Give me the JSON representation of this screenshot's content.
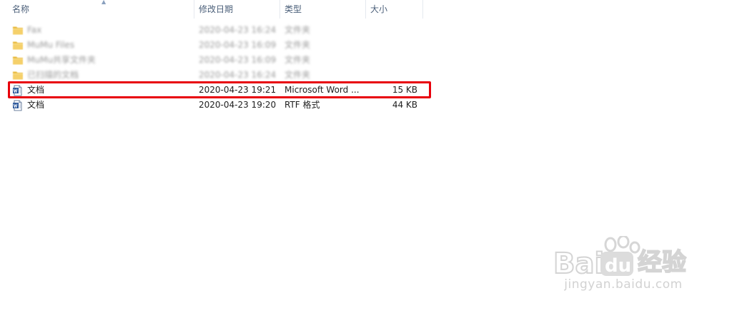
{
  "columns": {
    "name": "名称",
    "date": "修改日期",
    "type": "类型",
    "size": "大小"
  },
  "rows": [
    {
      "name": "Fax",
      "date": "2020-04-23 16:24",
      "type": "文件夹",
      "size": "",
      "icon": "folder-icon",
      "blurred": true
    },
    {
      "name": "MuMu Files",
      "date": "2020-04-23 16:09",
      "type": "文件夹",
      "size": "",
      "icon": "folder-icon",
      "blurred": true
    },
    {
      "name": "MuMu共享文件夹",
      "date": "2020-04-23 16:09",
      "type": "文件夹",
      "size": "",
      "icon": "folder-icon",
      "blurred": true
    },
    {
      "name": "已扫描的文档",
      "date": "2020-04-23 16:24",
      "type": "文件夹",
      "size": "",
      "icon": "folder-icon",
      "blurred": true
    },
    {
      "name": "文档",
      "date": "2020-04-23 19:21",
      "type": "Microsoft Word ...",
      "size": "15 KB",
      "icon": "word-document-icon",
      "blurred": false
    },
    {
      "name": "文档",
      "date": "2020-04-23 19:20",
      "type": "RTF 格式",
      "size": "44 KB",
      "icon": "word-document-icon",
      "blurred": false
    }
  ],
  "watermark": {
    "logo_text": "Baidu经验",
    "subtext": "jingyan.baidu.com"
  },
  "colors": {
    "highlight": "#e8000b",
    "header_text": "#4c607a",
    "folder": "#f2c44d",
    "word_icon": "#2b579a"
  }
}
